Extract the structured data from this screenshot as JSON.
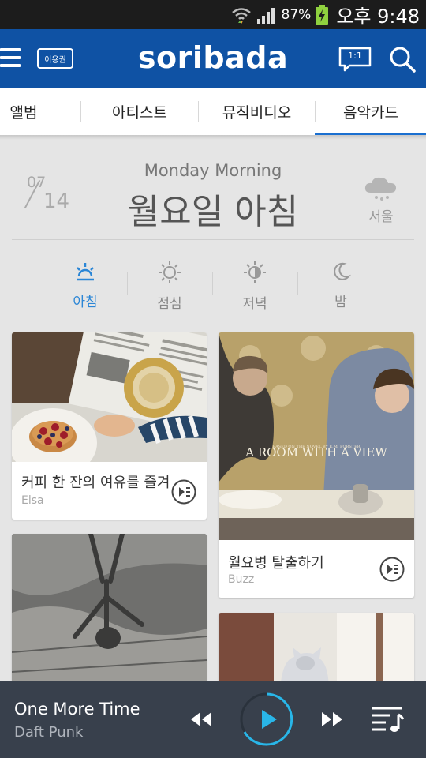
{
  "status_bar": {
    "battery_percent": "87%",
    "time": "오후 9:48"
  },
  "header": {
    "logo": "soribada",
    "ticket_label": "이용권",
    "chat_label": "1:1",
    "brand_color": "#0f52a4"
  },
  "tabs": [
    {
      "label": "앨범"
    },
    {
      "label": "아티스트"
    },
    {
      "label": "뮤직비디오"
    },
    {
      "label": "음악카드"
    }
  ],
  "active_tab": "음악카드",
  "date": {
    "month": "07",
    "day": "14"
  },
  "title": {
    "en": "Monday Morning",
    "ko": "월요일 아침"
  },
  "weather": {
    "city": "서울",
    "icon": "rain-cloud-icon"
  },
  "times_of_day": [
    {
      "label": "아침",
      "icon": "sunrise-icon"
    },
    {
      "label": "점심",
      "icon": "sun-icon"
    },
    {
      "label": "저녁",
      "icon": "half-sun-icon"
    },
    {
      "label": "밤",
      "icon": "moon-icon"
    }
  ],
  "active_time_of_day": "아침",
  "cards": [
    {
      "title": "커피 한 잔의 여유를 즐겨",
      "author": "Elsa",
      "image": "breakfast-photo"
    },
    {
      "title": "월요병 탈출하기",
      "author": "Buzz",
      "image": "movie-poster",
      "poster_text": "A ROOM WITH A VIEW",
      "poster_subtext": "BASED ON THE NOVEL BY E.M. FORSTER"
    },
    {
      "title": "",
      "author": "",
      "image": "puddle-reflection-photo"
    },
    {
      "title": "",
      "author": "",
      "image": "cat-window-photo"
    }
  ],
  "player": {
    "song": "One More Time",
    "artist": "Daft Punk",
    "accent_color": "#29b6e8"
  }
}
